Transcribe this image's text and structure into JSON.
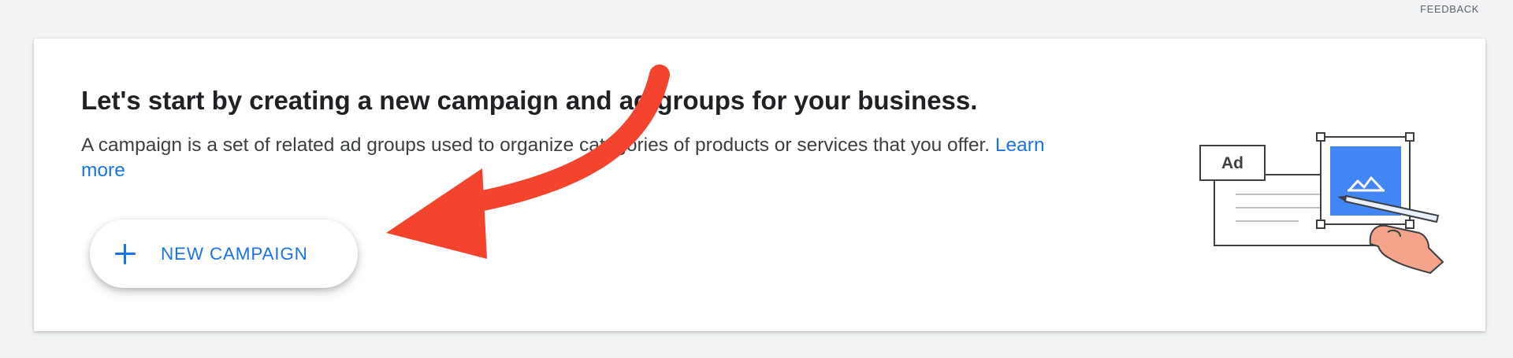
{
  "header": {
    "feedback_label": "FEEDBACK"
  },
  "card": {
    "title": "Let's start by creating a new campaign and ad groups for your business.",
    "description": "A campaign is a set of related ad groups used to organize categories of products or services that you offer.",
    "learn_more_label": "Learn more",
    "new_campaign_label": "NEW CAMPAIGN",
    "illustration": {
      "ad_label": "Ad"
    }
  },
  "colors": {
    "accent": "#1a73e8",
    "annotation_arrow": "#f4442e",
    "page_background": "#f1f3f4"
  },
  "icons": {
    "plus": "plus-icon",
    "image": "mountain-image-icon"
  }
}
